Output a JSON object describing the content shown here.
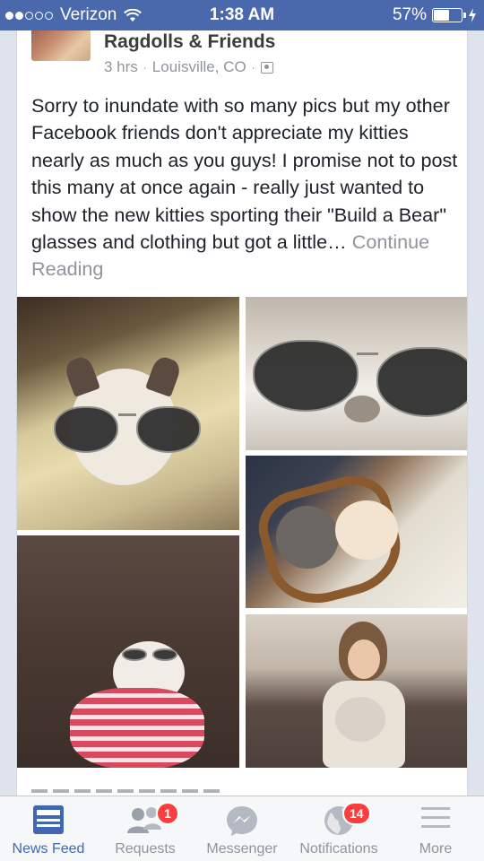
{
  "status_bar": {
    "carrier": "Verizon",
    "time": "1:38 AM",
    "battery_percent_text": "57%",
    "battery_level": 0.57,
    "signal_bars_filled": 2,
    "signal_bars_total": 5
  },
  "post": {
    "page_name": "Ragdolls & Friends",
    "time_ago": "3 hrs",
    "location": "Louisville, CO",
    "separator": "·",
    "text": "Sorry to inundate with so many pics but my other Facebook friends don't appreciate my kitties nearly as much as you guys!  I promise not to post this many at once again - really just wanted to show the new kitties sporting their \"Build a Bear\" glasses and clothing but got a little…",
    "continue_label": "Continue Reading",
    "photo_count": 5
  },
  "tab_bar": {
    "tabs": [
      {
        "label": "News Feed",
        "icon": "news-feed-icon",
        "active": true
      },
      {
        "label": "Requests",
        "icon": "friend-requests-icon",
        "badge": "1"
      },
      {
        "label": "Messenger",
        "icon": "messenger-icon"
      },
      {
        "label": "Notifications",
        "icon": "globe-icon",
        "badge": "14"
      },
      {
        "label": "More",
        "icon": "menu-icon"
      }
    ]
  },
  "colors": {
    "status_bar": "#4a69ad",
    "accent": "#4267b2",
    "badge": "#fa3e3e",
    "meta_text": "#90949c"
  }
}
